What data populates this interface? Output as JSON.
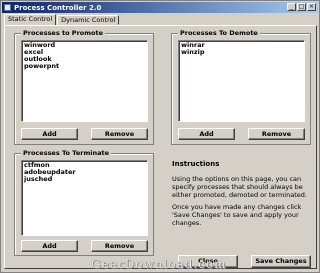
{
  "window": {
    "title": "Process Controller 2.0",
    "title_buttons": {
      "minimize": "_",
      "maximize": "□",
      "close": "×"
    }
  },
  "tabs": [
    {
      "label": "Static Control",
      "active": true
    },
    {
      "label": "Dynamic Control",
      "active": false
    }
  ],
  "promote": {
    "title": "Processes to Promote",
    "items": [
      "winword",
      "excel",
      "outlook",
      "powerpnt"
    ],
    "add_label": "Add",
    "remove_label": "Remove"
  },
  "demote": {
    "title": "Processes To Demote",
    "items": [
      "winrar",
      "winzip"
    ],
    "add_label": "Add",
    "remove_label": "Remove"
  },
  "terminate": {
    "title": "Processes To Terminate",
    "items": [
      "ctfmon",
      "adobeupdater",
      "jusched"
    ],
    "add_label": "Add",
    "remove_label": "Remove"
  },
  "instructions": {
    "title": "Instructions",
    "paragraph1": "Using the options on this page, you can specify processes that should always be either promoted, demoted or terminated.",
    "paragraph2": "Once you have made any changes click 'Save Changes' to save and apply your changes."
  },
  "footer": {
    "close_label": "Close",
    "save_label": "Save Changes"
  },
  "watermark": "GearDownload.com"
}
